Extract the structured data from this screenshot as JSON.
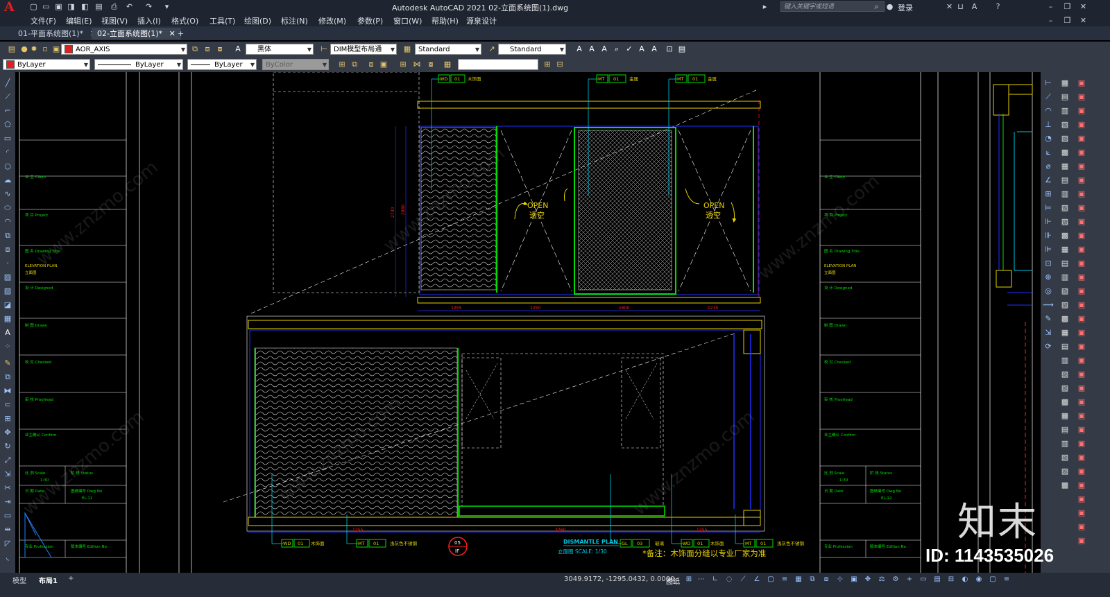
{
  "app": {
    "title": "Autodesk AutoCAD 2021    02-立面系统图(1).dwg",
    "logo": "A",
    "search_placeholder": "键入关键字或短语",
    "login": "登录"
  },
  "menu": [
    "文件(F)",
    "编辑(E)",
    "视图(V)",
    "插入(I)",
    "格式(O)",
    "工具(T)",
    "绘图(D)",
    "标注(N)",
    "修改(M)",
    "参数(P)",
    "窗口(W)",
    "帮助(H)",
    "源泉设计"
  ],
  "tabs": [
    {
      "label": "01-平面系统图(1)*",
      "active": false
    },
    {
      "label": "02-立面系统图(1)*",
      "active": true
    }
  ],
  "toolbar1": {
    "layer": "AOR_AXIS",
    "text_style": "黑体",
    "dim_style": "DIM模型布局通",
    "table_style": "Standard",
    "mleader_style": "Standard"
  },
  "toolbar2": {
    "color": "ByLayer",
    "linetype": "ByLayer",
    "lineweight": "ByLayer",
    "plotstyle": "ByColor"
  },
  "colors": {
    "accent_red": "#e02020",
    "cad_green": "#00e000",
    "cad_yellow": "#e6d200",
    "cad_blue": "#2030ff",
    "cad_cyan": "#00c8e0",
    "cad_red": "#ff2020",
    "cad_white": "#e8e8e8"
  },
  "drawing": {
    "upper_tags": [
      {
        "code": "WD",
        "num": "01",
        "label": "木饰面"
      },
      {
        "code": "MT",
        "num": "01",
        "label": "金属"
      },
      {
        "code": "MT",
        "num": "01",
        "label": "金属"
      }
    ],
    "open_text": [
      "OPEN",
      "透空"
    ],
    "upper_dims": [
      "1255",
      "1250",
      "1600",
      "1215"
    ],
    "upper_height_dims": [
      "2730",
      "2880"
    ],
    "lower_dims": [
      "1255",
      "3260",
      "1255"
    ],
    "lower_tags": [
      {
        "code": "WD",
        "num": "01",
        "label": "木饰面"
      },
      {
        "code": "MT",
        "num": "01",
        "label": "浅灰色不锈钢"
      },
      {
        "code": "GL",
        "num": "03",
        "label": "玻璃"
      },
      {
        "code": "WD",
        "num": "01",
        "label": "木饰面"
      },
      {
        "code": "MT",
        "num": "01",
        "label": "浅灰色不锈钢"
      }
    ],
    "plan_title": "DISMANTLE PLAN",
    "plan_subtitle": "立面图  SCALE: 1/30",
    "callout": {
      "top": "05",
      "bottom": "IF"
    },
    "note": "*备注：木饰面分缝以专业厂家为准",
    "titleblock": {
      "client": "业 主  Client",
      "project": "项 目  Project",
      "drawing_title": "图 名  Drawing Title",
      "elevation_en": "ELEVATION PLAN",
      "elevation_cn": "立面图",
      "designed": "设 计  Designed",
      "drawn": "制 图  Drawn",
      "checked": "校 对  Checked",
      "approved": "审 核  Proofread",
      "confirm": "业主确认  Confirm",
      "scale": "比 例  Scale",
      "scale_val": "1:30",
      "status": "阶 段  Status",
      "date": "日 期  Date",
      "dwg_no": "图纸编号  Dwg No",
      "dwg_no_val_left": "EL-11",
      "dwg_no_val_right": "EL-12",
      "profession": "专业  Profession",
      "edition": "版本编号  Edition No"
    }
  },
  "status": {
    "layouts": [
      "模型",
      "布局1"
    ],
    "coords": "3049.9172, -1295.0432, 0.0000",
    "mode": "图纸"
  },
  "watermark": {
    "brand": "知末",
    "id": "ID: 1143535026",
    "site": "www.znzmo.com"
  }
}
